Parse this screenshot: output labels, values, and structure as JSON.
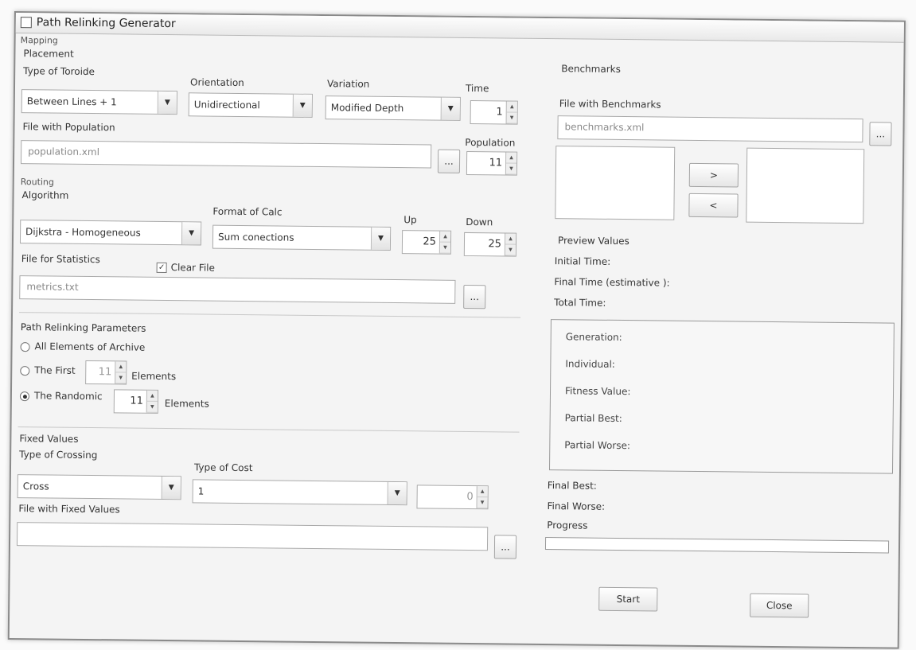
{
  "window": {
    "title": "Path Relinking Generator"
  },
  "mapping": {
    "section": "Mapping",
    "placement": "Placement",
    "type_label": "Type of Toroide",
    "type_value": "Between Lines + 1",
    "orientation_label": "Orientation",
    "orientation_value": "Unidirectional",
    "variation_label": "Variation",
    "variation_value": "Modified Depth",
    "time_label": "Time",
    "time_value": "1",
    "file_label": "File with Population",
    "file_value": "population.xml",
    "population_label": "Population",
    "population_value": "11",
    "browse": "..."
  },
  "routing": {
    "section": "Routing",
    "algorithm_label": "Algorithm",
    "algorithm_value": "Dijkstra - Homogeneous",
    "format_label": "Format of Calc",
    "format_value": "Sum conections",
    "up_label": "Up",
    "up_value": "25",
    "down_label": "Down",
    "down_value": "25",
    "stats_label": "File for Statistics",
    "clear_label": "Clear File",
    "clear_checked": true,
    "stats_value": "metrics.txt",
    "browse": "..."
  },
  "path": {
    "section": "Path Relinking Parameters",
    "opt_all": "All Elements of Archive",
    "opt_first": "The First",
    "first_value": "11",
    "first_suffix": "Elements",
    "opt_random": "The Randomic",
    "random_value": "11",
    "random_suffix": "Elements",
    "selected": "random"
  },
  "fixed": {
    "section": "Fixed Values",
    "crossing_label": "Type of Crossing",
    "crossing_value": "Cross",
    "cost_label": "Type of Cost",
    "cost_value": "1",
    "cost_spinner": "0",
    "file_label": "File with Fixed Values",
    "file_value": "",
    "browse": "..."
  },
  "benchmarks": {
    "section": "Benchmarks",
    "file_label": "File with Benchmarks",
    "file_value": "benchmarks.xml",
    "browse": "...",
    "add": ">",
    "remove": "<"
  },
  "preview": {
    "section": "Preview Values",
    "initial_time": "Initial Time:",
    "final_time": "Final Time (estimative ):",
    "total_time": "Total Time:",
    "generation": "Generation:",
    "individual": "Individual:",
    "fitness": "Fitness Value:",
    "partial_best": "Partial Best:",
    "partial_worse": "Partial Worse:",
    "final_best": "Final Best:",
    "final_worse": "Final Worse:",
    "progress_label": "Progress",
    "progress_value": 0.0
  },
  "buttons": {
    "start": "Start",
    "close": "Close"
  }
}
